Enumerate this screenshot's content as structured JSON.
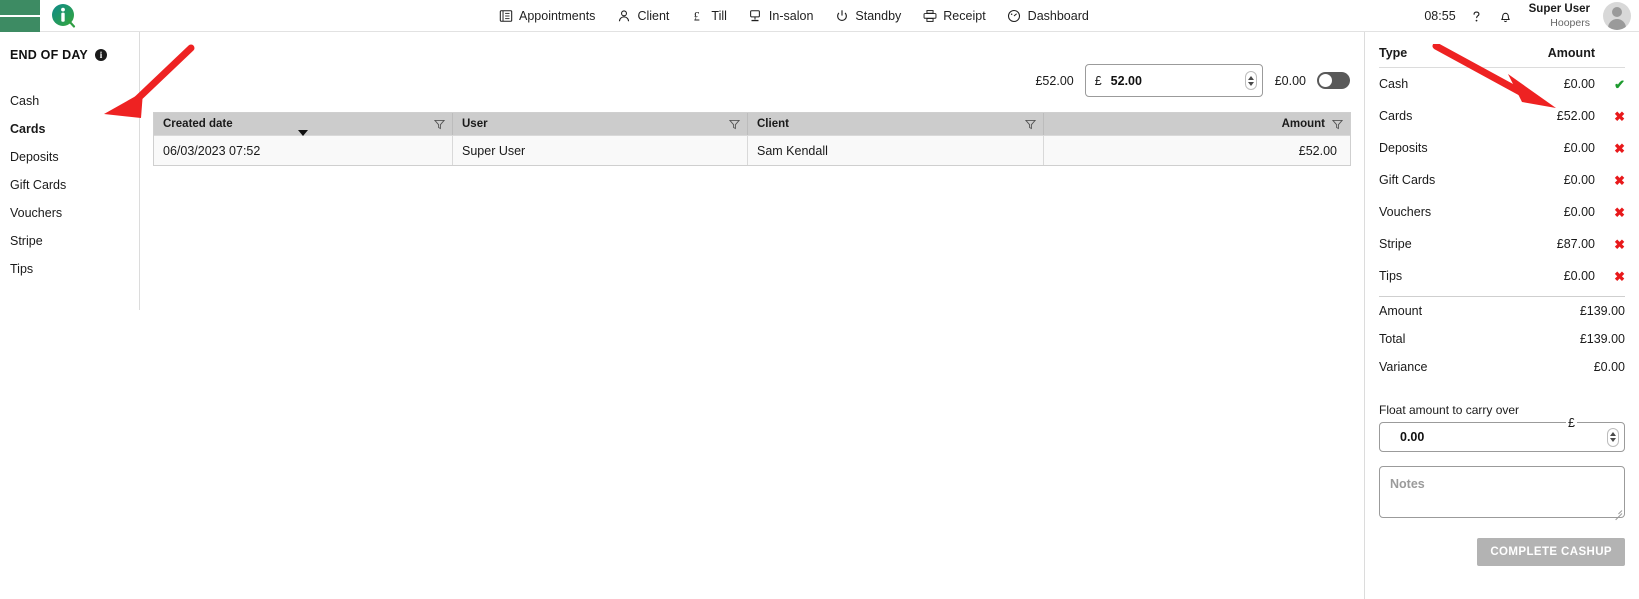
{
  "header": {
    "menu_icon": "hamburger-icon",
    "logo_icon": "brand-logo-icon",
    "clock": "08:55",
    "help_icon": "help-icon",
    "notification_icon": "bell-icon",
    "user_name": "Super User",
    "user_org": "Hoopers",
    "avatar_icon": "user-avatar-icon",
    "nav": [
      {
        "label": "Appointments",
        "icon": "appointments-icon"
      },
      {
        "label": "Client",
        "icon": "client-person-icon"
      },
      {
        "label": "Till",
        "icon": "pound-till-icon"
      },
      {
        "label": "In-salon",
        "icon": "in-salon-icon"
      },
      {
        "label": "Standby",
        "icon": "standby-icon"
      },
      {
        "label": "Receipt",
        "icon": "receipt-printer-icon"
      },
      {
        "label": "Dashboard",
        "icon": "dashboard-gauge-icon"
      }
    ]
  },
  "sidebar": {
    "title": "END OF DAY",
    "info_icon": "info-icon",
    "items": [
      {
        "label": "Cash",
        "active": false
      },
      {
        "label": "Cards",
        "active": true
      },
      {
        "label": "Deposits",
        "active": false
      },
      {
        "label": "Gift Cards",
        "active": false
      },
      {
        "label": "Vouchers",
        "active": false
      },
      {
        "label": "Stripe",
        "active": false
      },
      {
        "label": "Tips",
        "active": false
      }
    ]
  },
  "main": {
    "amount_bar": {
      "expected_label": "£52.00",
      "currency": "£",
      "input_value": "52.00",
      "difference_label": "£0.00",
      "toggle_state": "off"
    },
    "table": {
      "columns": [
        {
          "key": "created",
          "label": "Created date",
          "align": "left",
          "sorted": "desc",
          "filter_icon": "filter-funnel-icon"
        },
        {
          "key": "user",
          "label": "User",
          "align": "left",
          "filter_icon": "filter-funnel-icon"
        },
        {
          "key": "client",
          "label": "Client",
          "align": "left",
          "filter_icon": "filter-funnel-icon"
        },
        {
          "key": "amount",
          "label": "Amount",
          "align": "right",
          "filter_icon": "filter-funnel-icon"
        }
      ],
      "rows": [
        {
          "created": "06/03/2023 07:52",
          "user": "Super User",
          "client": "Sam Kendall",
          "amount": "£52.00"
        }
      ]
    }
  },
  "right_panel": {
    "header": {
      "type": "Type",
      "amount": "Amount"
    },
    "rows": [
      {
        "type": "Cash",
        "amount": "£0.00",
        "state": "ok",
        "state_glyph": "✔",
        "state_icon": "check-icon"
      },
      {
        "type": "Cards",
        "amount": "£52.00",
        "state": "no",
        "state_glyph": "✖",
        "state_icon": "cross-icon"
      },
      {
        "type": "Deposits",
        "amount": "£0.00",
        "state": "no",
        "state_glyph": "✖",
        "state_icon": "cross-icon"
      },
      {
        "type": "Gift Cards",
        "amount": "£0.00",
        "state": "no",
        "state_glyph": "✖",
        "state_icon": "cross-icon"
      },
      {
        "type": "Vouchers",
        "amount": "£0.00",
        "state": "no",
        "state_glyph": "✖",
        "state_icon": "cross-icon"
      },
      {
        "type": "Stripe",
        "amount": "£87.00",
        "state": "no",
        "state_glyph": "✖",
        "state_icon": "cross-icon"
      },
      {
        "type": "Tips",
        "amount": "£0.00",
        "state": "no",
        "state_glyph": "✖",
        "state_icon": "cross-icon"
      }
    ],
    "totals": [
      {
        "label": "Amount",
        "value": "£139.00"
      },
      {
        "label": "Total",
        "value": "£139.00"
      },
      {
        "label": "Variance",
        "value": "£0.00"
      }
    ],
    "float": {
      "label": "Float amount to carry over",
      "currency": "£",
      "value": "0.00"
    },
    "notes": {
      "placeholder": "Notes",
      "value": ""
    },
    "complete_button": "COMPLETE CASHUP"
  },
  "annotations": {
    "arrow_color": "#ee2222",
    "arrows": [
      {
        "name": "sidebar-arrow",
        "points_to": "Cards"
      },
      {
        "name": "right-panel-arrow",
        "points_to": "Cash status"
      }
    ]
  },
  "colors": {
    "brand_green": "#3d8b63",
    "header_bg": "#ffffff",
    "grid_header_bg": "#cccccc",
    "ok_green": "#1d9b2e",
    "error_red": "#e8191b",
    "button_disabled": "#b3b3b3"
  }
}
